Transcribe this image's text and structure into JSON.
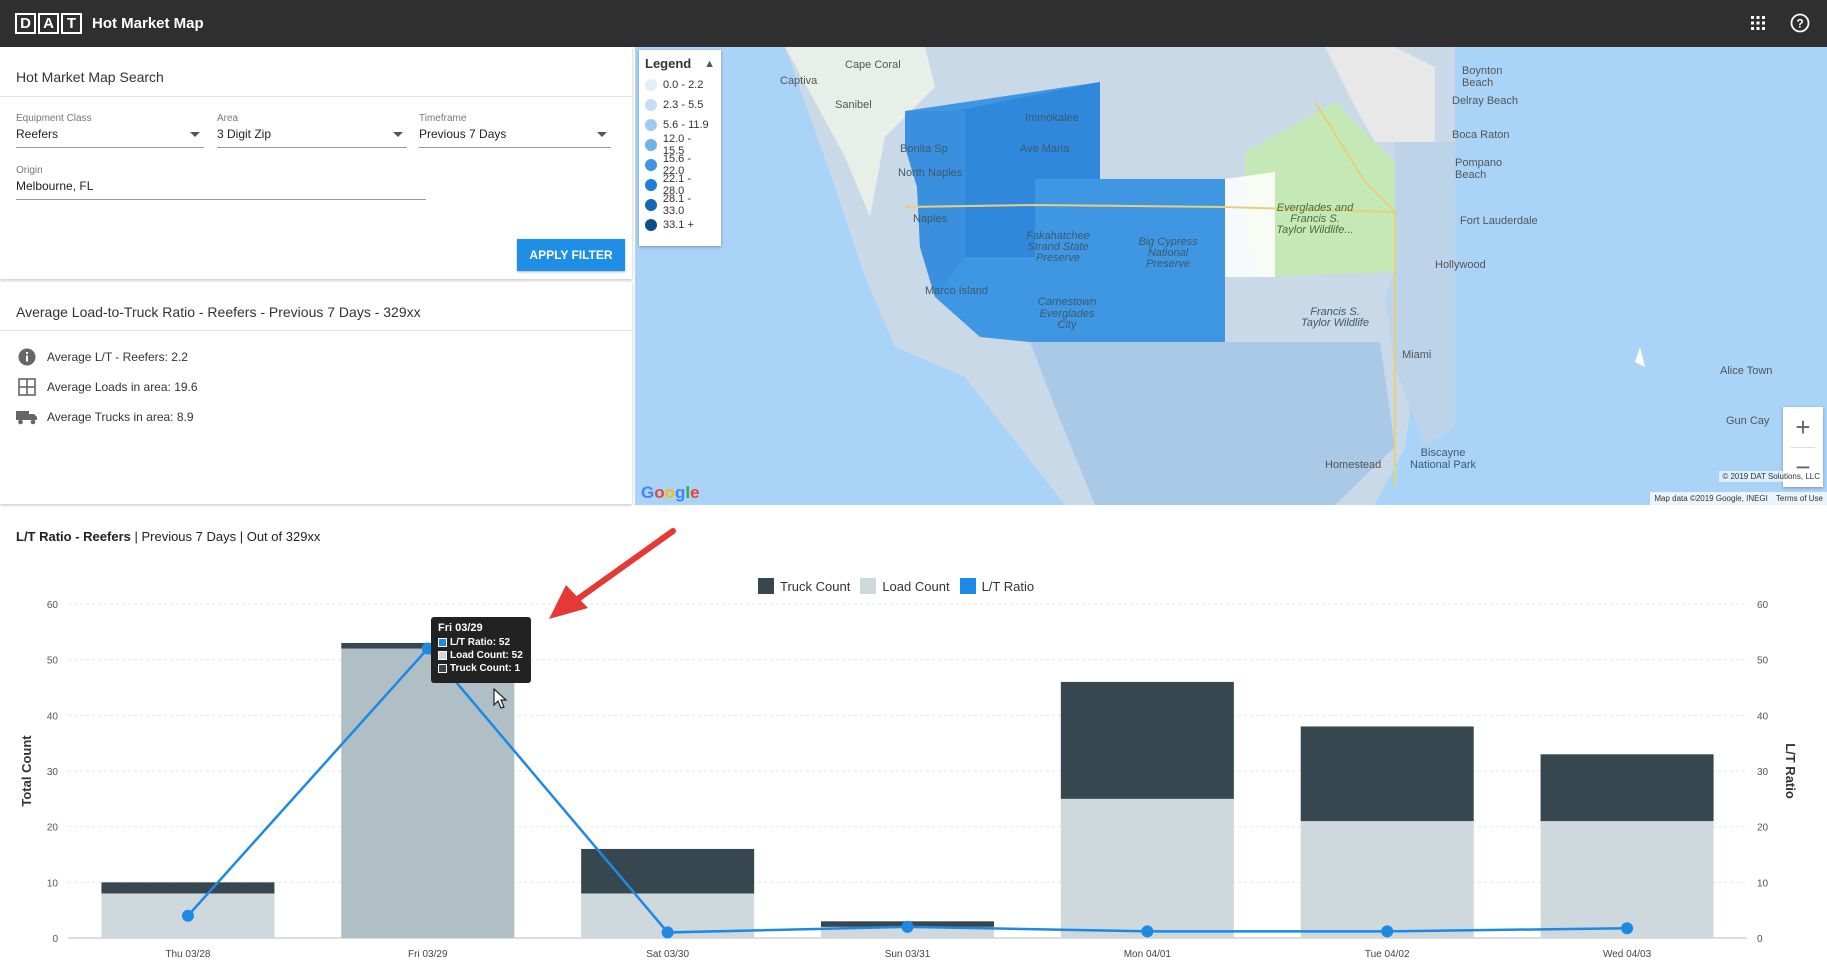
{
  "header": {
    "logo_letters": [
      "D",
      "A",
      "T"
    ],
    "app_title": "Hot Market Map",
    "icons": [
      "apps-grid-icon",
      "help-icon"
    ]
  },
  "search": {
    "title": "Hot Market Map Search",
    "equipment_label": "Equipment Class",
    "equipment_value": "Reefers",
    "area_label": "Area",
    "area_value": "3 Digit Zip",
    "timeframe_label": "Timeframe",
    "timeframe_value": "Previous 7 Days",
    "origin_label": "Origin",
    "origin_value": "Melbourne, FL",
    "apply_label": "APPLY FILTER"
  },
  "stats": {
    "title": "Average Load-to-Truck Ratio - Reefers - Previous 7 Days - 329xx",
    "lt": "Average L/T - Reefers: 2.2",
    "loads": "Average Loads in area: 19.6",
    "trucks": "Average Trucks in area: 8.9"
  },
  "map": {
    "legend_title": "Legend",
    "legend": [
      {
        "label": "0.0 - 2.2",
        "color": "#e3eef8"
      },
      {
        "label": "2.3 - 5.5",
        "color": "#c6def5"
      },
      {
        "label": "5.6 - 11.9",
        "color": "#9ccbf0"
      },
      {
        "label": "12.0 - 15.5",
        "color": "#6fb2ea"
      },
      {
        "label": "15.6 - 22.0",
        "color": "#3f97e3"
      },
      {
        "label": "22.1 - 28.0",
        "color": "#1e7fd6"
      },
      {
        "label": "28.1 - 33.0",
        "color": "#1467b5"
      },
      {
        "label": "33.1 +",
        "color": "#0b4f8f"
      }
    ],
    "labels": {
      "cape_coral": "Cape Coral",
      "captiva": "Captiva",
      "sanibel": "Sanibel",
      "immokalee": "Immokalee",
      "ave_maria": "Ave Maria",
      "bonita": "Bonita Sp",
      "north_naples": "North Naples",
      "naples": "Naples",
      "marco": "Marco Island",
      "fakahatchee": "Fakahatchee Strand State Preserve",
      "big_cypress": "Big Cypress National Preserve",
      "carnestown": "Carnestown",
      "everglades_city": "Everglades City",
      "everglades_park": "Everglades and Francis S. Taylor Wildlife...",
      "francis": "Francis S. Taylor Wildlife",
      "boynton": "Boynton Beach",
      "delray": "Delray Beach",
      "boca": "Boca Raton",
      "pompano": "Pompano Beach",
      "fort": "Fort Lauderdale",
      "hollywood": "Hollywood",
      "miami": "Miami",
      "homestead": "Homestead",
      "biscayne": "Biscayne National Park",
      "alice": "Alice Town",
      "gun": "Gun Cay"
    },
    "google": "Google",
    "copyright": "© 2019 DAT Solutions, LLC",
    "map_data": "Map data ©2019 Google, INEGI",
    "terms": "Terms of Use",
    "zoom_in": "+",
    "zoom_out": "−"
  },
  "chart_title": {
    "bold": "L/T Ratio - Reefers",
    "rest": " | Previous 7 Days | Out of 329xx"
  },
  "tooltip": {
    "title": "Fri 03/29",
    "lt": "L/T Ratio: 52",
    "load": "Load Count: 52",
    "truck": "Truck Count: 1"
  },
  "chart_data": {
    "type": "bar",
    "categories": [
      "Thu 03/28",
      "Fri 03/29",
      "Sat 03/30",
      "Sun 03/31",
      "Mon 04/01",
      "Tue 04/02",
      "Wed 04/03"
    ],
    "series": [
      {
        "name": "Truck Count",
        "type": "bar-stacked",
        "color": "#37474f",
        "values": [
          2,
          1,
          8,
          1,
          21,
          17,
          12
        ]
      },
      {
        "name": "Load Count",
        "type": "bar-stacked",
        "color": "#cfd8dc",
        "values": [
          8,
          52,
          8,
          2,
          25,
          21,
          21
        ]
      },
      {
        "name": "L/T Ratio",
        "type": "line",
        "color": "#1e88e5",
        "values": [
          4,
          52,
          1,
          2,
          1.2,
          1.2,
          1.75
        ]
      }
    ],
    "ylabel": "Total Count",
    "y2label": "L/T Ratio",
    "ylim": [
      0,
      60
    ],
    "y2lim": [
      0,
      60
    ],
    "yticks": [
      0,
      10,
      20,
      30,
      40,
      50,
      60
    ],
    "highlighted_category": "Fri 03/29",
    "highlight_color": "#b0bec5",
    "legend": "top-center",
    "grid": true
  }
}
